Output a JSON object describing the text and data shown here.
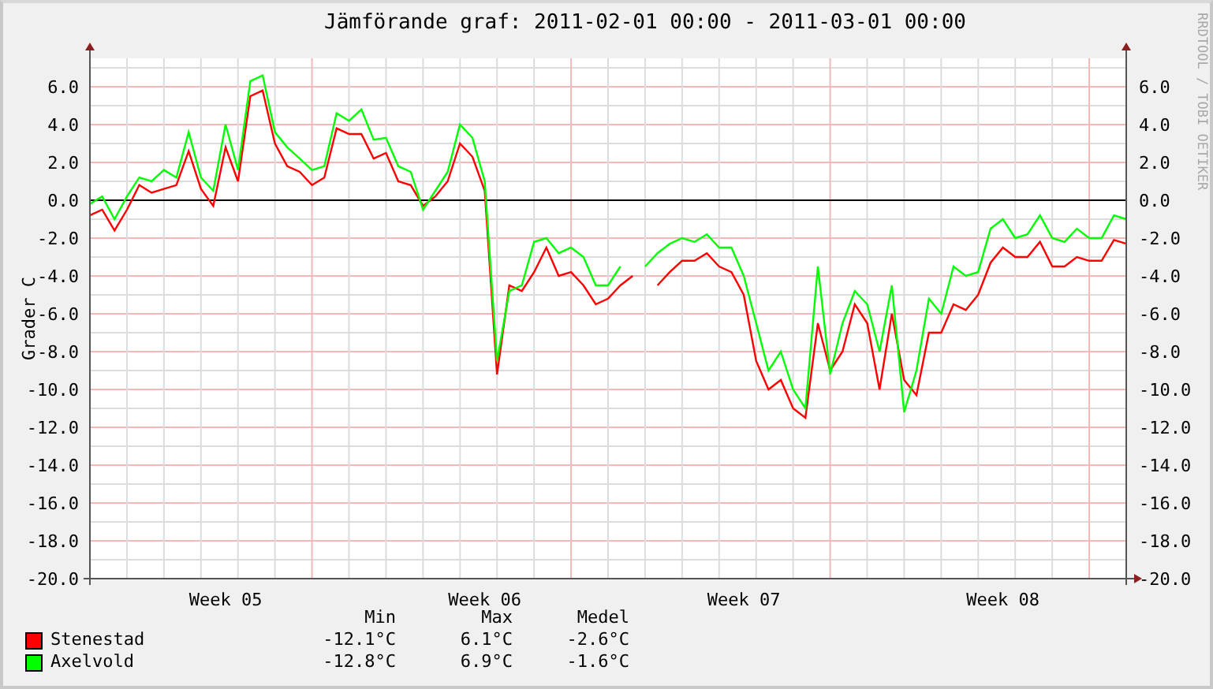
{
  "title": "Jämförande graf: 2011-02-01 00:00 - 2011-03-01 00:00",
  "credit": "RRDTOOL / TOBI OETIKER",
  "chart_data": {
    "type": "line",
    "ylabel": "Grader C",
    "grid": true,
    "ylim": [
      -20,
      7.5
    ],
    "y2lim": [
      -20,
      7.5
    ],
    "categories": [
      null,
      null,
      null,
      null,
      null,
      null,
      null,
      null,
      null,
      null,
      null,
      "Week 05",
      null,
      null,
      null,
      null,
      null,
      null,
      null,
      null,
      null,
      null,
      null,
      null,
      null,
      null,
      null,
      null,
      null,
      null,
      null,
      null,
      "Week 06",
      null,
      null,
      null,
      null,
      null,
      null,
      null,
      null,
      null,
      null,
      null,
      null,
      null,
      null,
      null,
      null,
      null,
      null,
      null,
      null,
      "Week 07",
      null,
      null,
      null,
      null,
      null,
      null,
      null,
      null,
      null,
      null,
      null,
      null,
      null,
      null,
      null,
      null,
      null,
      null,
      null,
      null,
      "Week 08",
      null,
      null,
      null,
      null,
      null,
      null,
      null,
      null,
      null,
      null
    ],
    "yticks": [
      {
        "value": 6,
        "label": "6.0"
      },
      {
        "value": 4,
        "label": "4.0"
      },
      {
        "value": 2,
        "label": "2.0"
      },
      {
        "value": 0,
        "label": "0.0"
      },
      {
        "value": -2,
        "label": "-2.0"
      },
      {
        "value": -4,
        "label": "-4.0"
      },
      {
        "value": -6,
        "label": "-6.0"
      },
      {
        "value": -8,
        "label": "-8.0"
      },
      {
        "value": -10,
        "label": "-10.0"
      },
      {
        "value": -12,
        "label": "-12.0"
      },
      {
        "value": -14,
        "label": "-14.0"
      },
      {
        "value": -16,
        "label": "-16.0"
      },
      {
        "value": -18,
        "label": "-18.0"
      },
      {
        "value": -20,
        "label": "-20.0"
      }
    ],
    "y2ticks": [
      {
        "value": 6,
        "label": "6.0"
      },
      {
        "value": 4,
        "label": "4.0"
      },
      {
        "value": 2,
        "label": "2.0"
      },
      {
        "value": 0,
        "label": "0.0"
      },
      {
        "value": -2,
        "label": "-2.0"
      },
      {
        "value": -4,
        "label": "-4.0"
      },
      {
        "value": -6,
        "label": "-6.0"
      },
      {
        "value": -8,
        "label": "-8.0"
      },
      {
        "value": -10,
        "label": "-10.0"
      },
      {
        "value": -12,
        "label": "-12.0"
      },
      {
        "value": -14,
        "label": "-14.0"
      },
      {
        "value": -16,
        "label": "-16.0"
      },
      {
        "value": -18,
        "label": "-18.0"
      },
      {
        "value": -20,
        "label": "-20.0"
      }
    ],
    "series": [
      {
        "name": "Stenestad",
        "color": "#ff0000",
        "values": [
          -0.8,
          -0.5,
          -1.6,
          -0.5,
          0.8,
          0.4,
          0.6,
          0.8,
          2.6,
          0.6,
          -0.3,
          2.8,
          1.0,
          5.5,
          5.8,
          3.0,
          1.8,
          1.5,
          0.8,
          1.2,
          3.8,
          3.5,
          3.5,
          2.2,
          2.5,
          1.0,
          0.8,
          -0.3,
          0.2,
          1.0,
          3.0,
          2.3,
          0.5,
          -9.2,
          -4.5,
          -4.8,
          -3.8,
          -2.5,
          -4.0,
          -3.8,
          -4.5,
          -5.5,
          -5.2,
          -4.5,
          -4.0,
          null,
          -4.5,
          -3.8,
          -3.2,
          -3.2,
          -2.8,
          -3.5,
          -3.8,
          -5.0,
          -8.5,
          -10.0,
          -9.5,
          -11.0,
          -11.5,
          -6.5,
          -9.0,
          -8.0,
          -5.5,
          -6.5,
          -10.0,
          -6.0,
          -9.5,
          -10.3,
          -7.0,
          -7.0,
          -5.5,
          -5.8,
          -5.0,
          -3.3,
          -2.5,
          -3.0,
          -3.0,
          -2.2,
          -3.5,
          -3.5,
          -3.0,
          -3.2,
          -3.2,
          -2.1,
          -2.3
        ]
      },
      {
        "name": "Axelvold",
        "color": "#00ff00",
        "values": [
          -0.2,
          0.2,
          -1.0,
          0.2,
          1.2,
          1.0,
          1.6,
          1.2,
          3.6,
          1.2,
          0.5,
          4.0,
          1.6,
          6.3,
          6.6,
          3.6,
          2.8,
          2.2,
          1.6,
          1.8,
          4.6,
          4.2,
          4.8,
          3.2,
          3.3,
          1.8,
          1.5,
          -0.5,
          0.5,
          1.5,
          4.0,
          3.3,
          1.0,
          -8.5,
          -4.8,
          -4.5,
          -2.2,
          -2.0,
          -2.8,
          -2.5,
          -3.0,
          -4.5,
          -4.5,
          -3.5,
          null,
          -3.5,
          -2.8,
          -2.3,
          -2.0,
          -2.2,
          -1.8,
          -2.5,
          -2.5,
          -4.0,
          -6.5,
          -9.0,
          -8.0,
          -10.0,
          -11.0,
          -3.5,
          -9.2,
          -6.5,
          -4.8,
          -5.5,
          -8.0,
          -4.5,
          -11.2,
          -9.0,
          -5.2,
          -6.0,
          -3.5,
          -4.0,
          -3.8,
          -1.5,
          -1.0,
          -2.0,
          -1.8,
          -0.8,
          -2.0,
          -2.2,
          -1.5,
          -2.0,
          -2.0,
          -0.8,
          -1.0
        ]
      }
    ]
  },
  "legend": {
    "headers": [
      "Min",
      "Max",
      "Medel"
    ],
    "rows": [
      {
        "values": [
          "-12.1°C",
          "6.1°C",
          "-2.6°C"
        ]
      },
      {
        "values": [
          "-12.8°C",
          "6.9°C",
          "-1.6°C"
        ]
      }
    ]
  }
}
